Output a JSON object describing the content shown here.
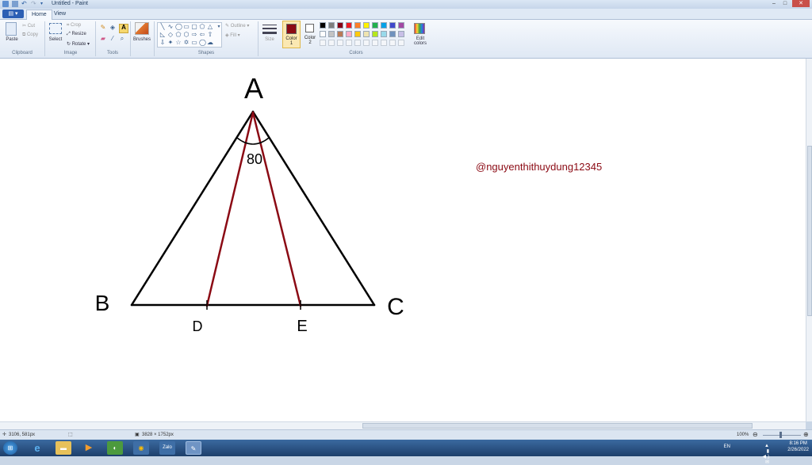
{
  "window": {
    "title": "Untitled - Paint",
    "controls": {
      "minimize": "–",
      "maximize": "□",
      "close": "✕"
    }
  },
  "tabs": {
    "file": "▤ ▾",
    "home": "Home",
    "view": "View"
  },
  "ribbon": {
    "clipboard": {
      "paste": "Paste",
      "cut": "Cut",
      "copy": "Copy",
      "label": "Clipboard"
    },
    "image": {
      "select": "Select",
      "crop": "Crop",
      "resize": "Resize",
      "rotate": "Rotate",
      "label": "Image"
    },
    "tools": {
      "label": "Tools"
    },
    "brushes": {
      "label": "Brushes"
    },
    "shapes": {
      "outline": "Outline",
      "fill": "Fill",
      "label": "Shapes"
    },
    "size": {
      "label": "Size"
    },
    "color1": {
      "label": "Color",
      "num": "1",
      "value": "#8b0a14"
    },
    "color2": {
      "label": "Color",
      "num": "2",
      "value": "#ffffff"
    },
    "edit_colors": {
      "line1": "Edit",
      "line2": "colors"
    },
    "colors_label": "Colors",
    "palette_row1": [
      "#000000",
      "#7f7f7f",
      "#880015",
      "#ed1c24",
      "#ff7f27",
      "#fff200",
      "#22b14c",
      "#00a2e8",
      "#3f48cc",
      "#a349a4"
    ],
    "palette_row2": [
      "#ffffff",
      "#c3c3c3",
      "#b97a57",
      "#ffaec9",
      "#ffc90e",
      "#efe4b0",
      "#b5e61d",
      "#99d9ea",
      "#7092be",
      "#c8bfe7"
    ]
  },
  "drawing": {
    "vertices": {
      "a": "A",
      "b": "B",
      "c": "C",
      "d": "D",
      "e": "E"
    },
    "angle_label": "80",
    "watermark": "@nguyenthithuydung12345",
    "watermark_color": "#8b0a14",
    "stroke_black": "#000000",
    "stroke_red": "#8b0a14"
  },
  "statusbar": {
    "cursor_pos": "3106, 581px",
    "image_size": "3828 × 1752px",
    "zoom": "100%"
  },
  "taskbar": {
    "apps": [
      "start-orb",
      "internet-explorer",
      "file-explorer",
      "media-player",
      "coccoc",
      "chrome",
      "zalo",
      "paint"
    ],
    "zalo_label": "Zalo",
    "lang": "EN",
    "time": "8:16 PM",
    "date": "2/26/2022"
  }
}
